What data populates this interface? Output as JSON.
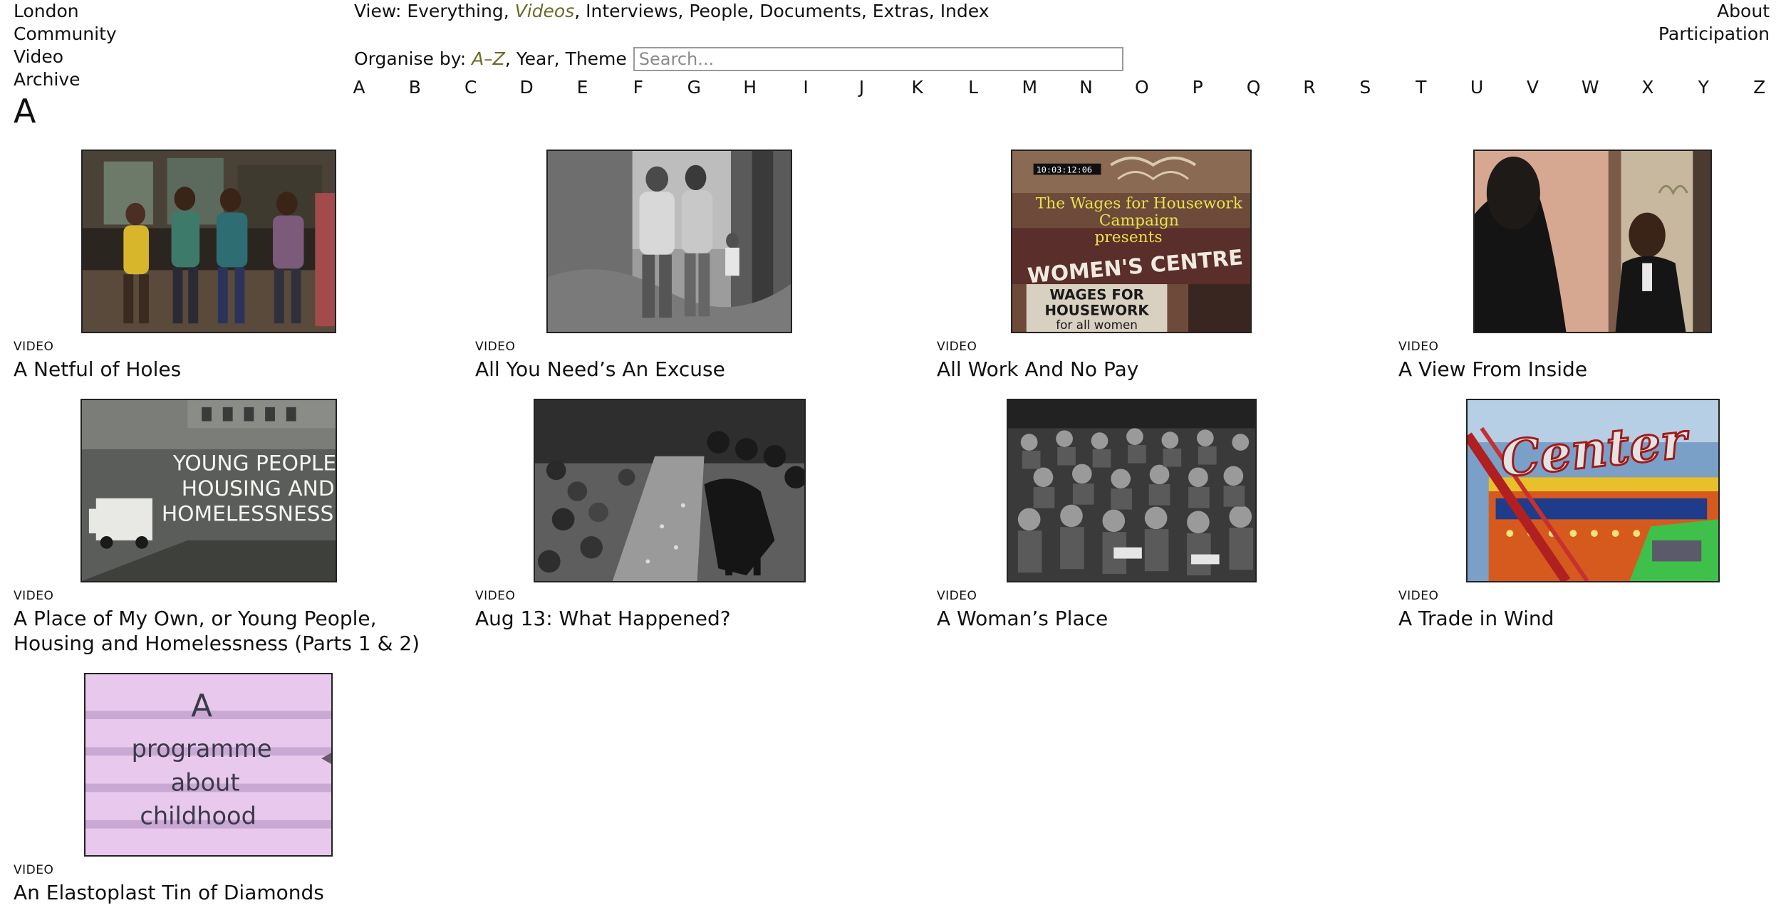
{
  "site_nav": [
    "London",
    "Community",
    "Video",
    "Archive"
  ],
  "current_letter": "A",
  "right_nav": [
    "About",
    "Participation"
  ],
  "view": {
    "label": "View:",
    "options": [
      "Everything",
      "Videos",
      "Interviews",
      "People",
      "Documents",
      "Extras",
      "Index"
    ],
    "active": "Videos"
  },
  "organise": {
    "label": "Organise by:",
    "options": [
      "A–Z",
      "Year",
      "Theme"
    ],
    "active": "A–Z"
  },
  "search": {
    "placeholder": "Search...",
    "value": ""
  },
  "alphabet": [
    "A",
    "B",
    "C",
    "D",
    "E",
    "F",
    "G",
    "H",
    "I",
    "J",
    "K",
    "L",
    "M",
    "N",
    "O",
    "P",
    "Q",
    "R",
    "S",
    "T",
    "U",
    "V",
    "W",
    "X",
    "Y",
    "Z"
  ],
  "videos": [
    {
      "kind": "VIDEO",
      "title": "A Netful of Holes",
      "thumb": "dancing-kids-still"
    },
    {
      "kind": "VIDEO",
      "title": "All You Need’s An Excuse",
      "thumb": "two-men-in-garden-still"
    },
    {
      "kind": "VIDEO",
      "title": "All Work And No Pay",
      "thumb": "womens-centre-still"
    },
    {
      "kind": "VIDEO",
      "title": "A View From Inside",
      "thumb": "doorway-conversation-still"
    },
    {
      "kind": "VIDEO",
      "title": "A Place of My Own, or Young People, Housing and Homelessness (Parts 1 & 2)",
      "thumb": "young-people-housing-still"
    },
    {
      "kind": "VIDEO",
      "title": "Aug 13: What Happened?",
      "thumb": "street-clash-still"
    },
    {
      "kind": "VIDEO",
      "title": "A Woman’s Place",
      "thumb": "seated-audience-still"
    },
    {
      "kind": "VIDEO",
      "title": "A Trade in Wind",
      "thumb": "fairground-ride-still"
    },
    {
      "kind": "VIDEO",
      "title": "An Elastoplast Tin of Diamonds",
      "thumb": "handwritten-titlecard-still"
    }
  ],
  "thumb_text": {
    "womens_timecode": "10:03:12:06",
    "womens_overlay": [
      "The Wages for Housework",
      "Campaign",
      "presents"
    ],
    "womens_sign": "WOMEN'S CENTRE",
    "womens_banner": [
      "WAGES FOR",
      "HOUSEWORK",
      "for all women"
    ],
    "housing_card": [
      "YOUNG PEOPLE,",
      "HOUSING AND",
      "HOMELESSNESS."
    ],
    "fair_sign": "Center",
    "childhood_card": [
      "A",
      "programme",
      "about",
      "childhood"
    ]
  },
  "colors": {
    "text": "#111111",
    "active": "#6b6a2a",
    "thumb_border": "#222222",
    "search_border": "#9a9a9a"
  }
}
